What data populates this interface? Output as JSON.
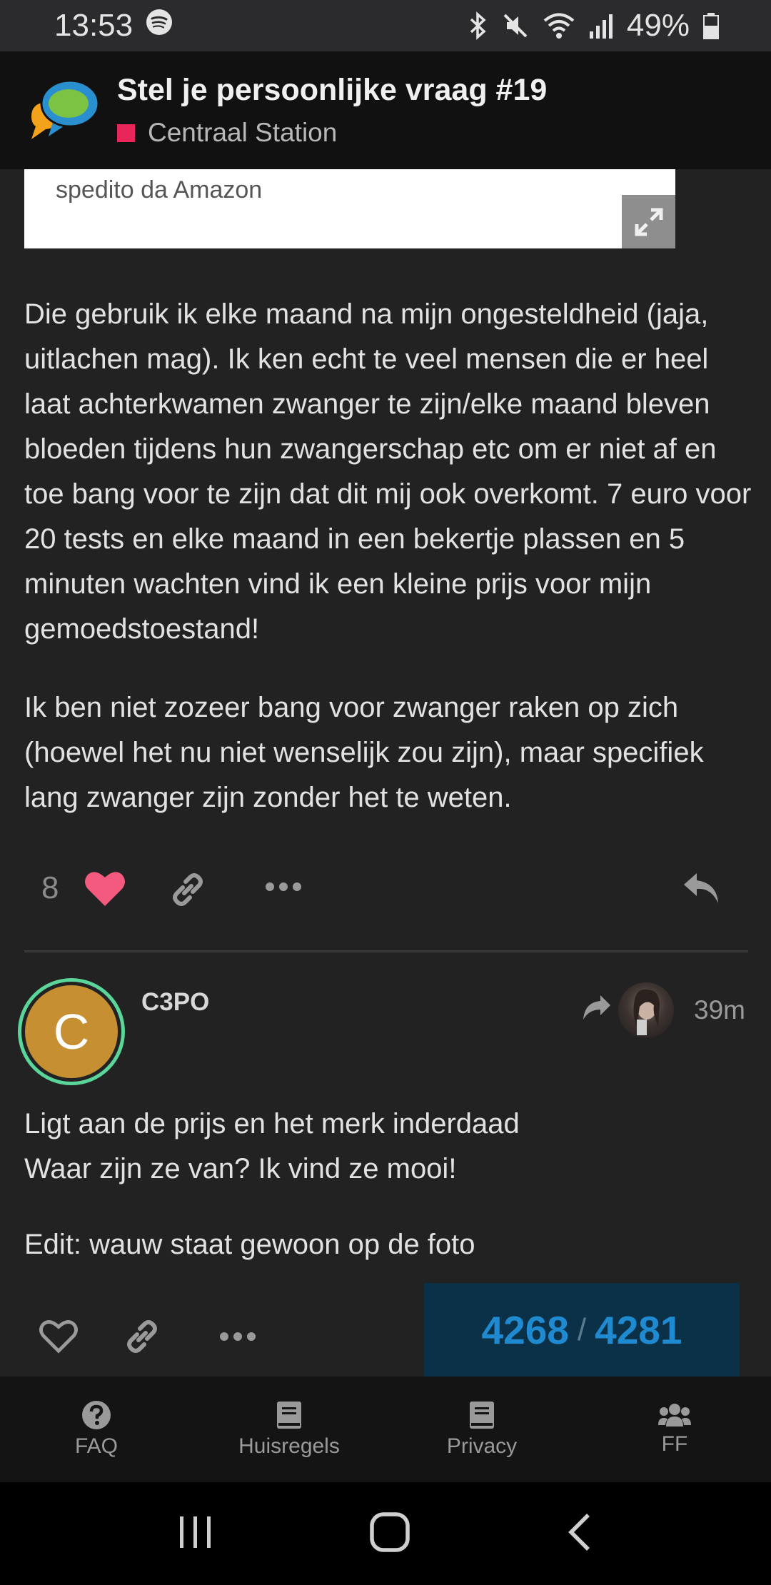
{
  "status_bar": {
    "time": "13:53",
    "battery": "49%"
  },
  "header": {
    "title": "Stel je persoonlijke vraag #19",
    "category": "Centraal Station",
    "category_color": "#e8265a"
  },
  "embed": {
    "text": "spedito da Amazon"
  },
  "post1": {
    "paragraphs": [
      "Die gebruik ik elke maand na mijn ongesteldheid (jaja, uitlachen mag). Ik ken echt te veel mensen die er heel laat achterkwamen zwanger te zijn/elke maand bleven bloeden tijdens hun zwangerschap etc om er niet af en toe bang voor te zijn dat dit mij ook overkomt. 7 euro voor 20 tests en elke maand in een bekertje plassen en 5 minuten wachten vind ik een kleine prijs voor mijn gemoedstoestand!",
      "Ik ben niet zozeer bang voor zwanger raken op zich (hoewel het nu niet wenselijk zou zijn), maar specifiek lang zwanger zijn zonder het te weten."
    ],
    "like_count": "8"
  },
  "post2": {
    "avatar_letter": "C",
    "username": "C3PO",
    "time": "39m",
    "lines": [
      "Ligt aan de prijs en het merk inderdaad",
      "Waar zijn ze van? Ik vind ze mooi!"
    ],
    "edit": "Edit: wauw staat gewoon op de foto"
  },
  "progress": {
    "current": "4268",
    "separator": "/",
    "total": "4281"
  },
  "bottom_nav": [
    {
      "label": "FAQ",
      "icon": "question-circle-icon"
    },
    {
      "label": "Huisregels",
      "icon": "book-icon"
    },
    {
      "label": "Privacy",
      "icon": "book-icon"
    },
    {
      "label": "FF",
      "icon": "users-icon"
    }
  ],
  "colors": {
    "like_heart": "#f45a7e",
    "progress_bg": "#0a3147",
    "progress_text": "#1f8ad0",
    "avatar_ring": "#5bd69a",
    "avatar_bg": "#c68f32"
  }
}
